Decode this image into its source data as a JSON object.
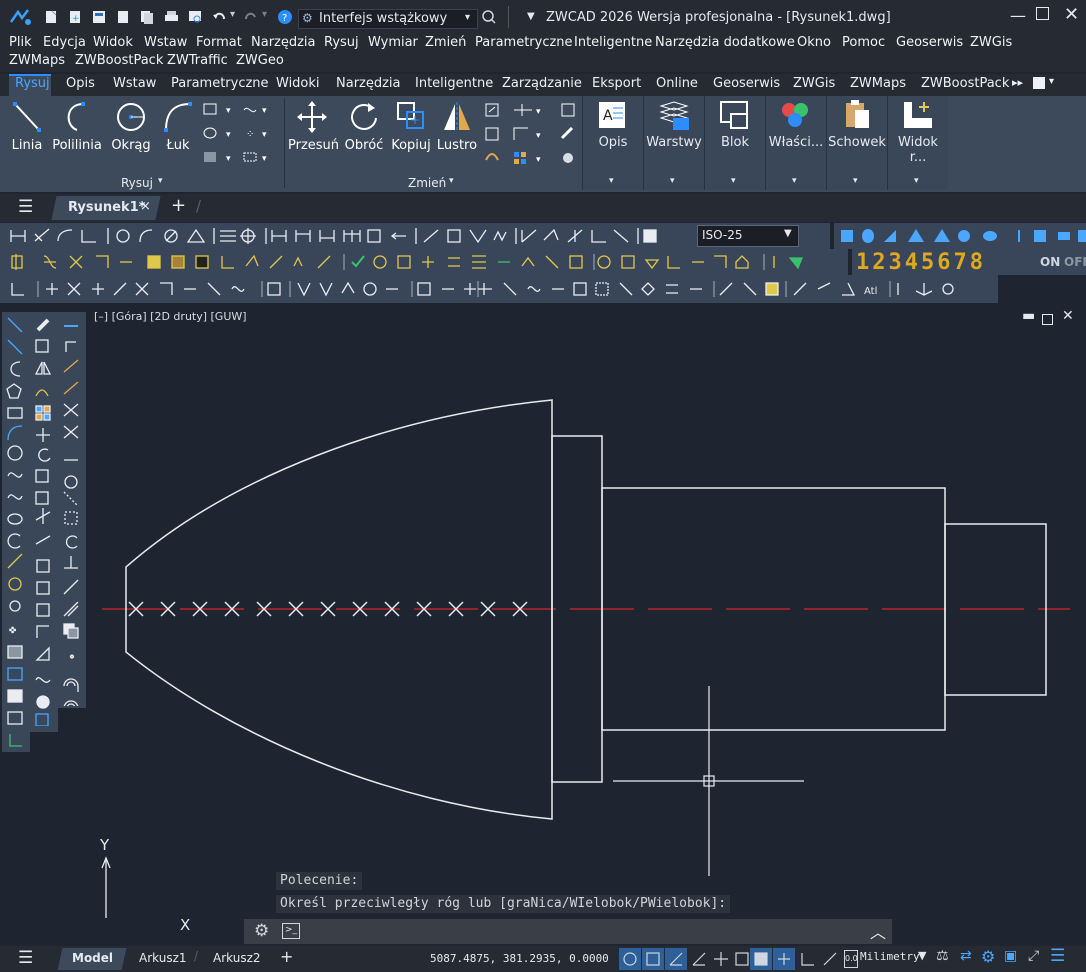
{
  "app": {
    "interface_name": "Interfejs wstążkowy",
    "title": "ZWCAD 2026 Wersja profesjonalna - [Rysunek1.dwg]",
    "window_controls": [
      "minimize-icon",
      "maximize-icon",
      "close-icon"
    ]
  },
  "menubar": {
    "row1": [
      "Plik",
      "Edycja",
      "Widok",
      "Wstaw",
      "Format",
      "Narzędzia",
      "Rysuj",
      "Wymiar",
      "Zmień",
      "Parametryczne",
      "Inteligentne",
      "Narzędzia dodatkowe",
      "Okno",
      "Pomoc",
      "Geoserwis",
      "ZWGis"
    ],
    "row2": [
      "ZWMaps",
      "ZWBoostPack",
      "ZWTraffic",
      "ZWGeo"
    ]
  },
  "ribbon_tabs": [
    "Rysuj",
    "Opis",
    "Wstaw",
    "Parametryczne",
    "Widoki",
    "Narzędzia",
    "Inteligentne",
    "Zarządzanie",
    "Eksport",
    "Online",
    "Geoserwis",
    "ZWGis",
    "ZWMaps",
    "ZWBoostPack"
  ],
  "ribbon": {
    "draw_buttons": [
      "Linia",
      "Polilinia",
      "Okrąg",
      "Łuk"
    ],
    "draw_panel_title": "Rysuj",
    "modify_buttons": [
      "Przesuń",
      "Obróć",
      "Kopiuj",
      "Lustro"
    ],
    "modify_panel_title": "Zmień",
    "panels": [
      "Opis",
      "Warstwy",
      "Blok",
      "Właści...",
      "Schowek",
      "Widok r..."
    ]
  },
  "doc_tab": {
    "label": "Rysunek1*",
    "close": "×",
    "add": "+"
  },
  "toolbar": {
    "dimstyle": "ISO-25",
    "layer_digits": "12345678",
    "on_label": "ON",
    "off_label": "OFF"
  },
  "viewport": {
    "label": "[–] [Góra] [2D druty] [GUW]"
  },
  "ucs": {
    "x": "X",
    "y": "Y"
  },
  "command": {
    "line1": "Polecenie:",
    "line2": "Określ przeciwległy róg lub [graNica/WIelobok/PWielobok]:"
  },
  "status": {
    "tabs": [
      "Model",
      "Arkusz1",
      "Arkusz2"
    ],
    "coords": "5087.4875, 381.2935, 0.0000",
    "units": "Milimetry"
  },
  "colors": {
    "accent": "#2d8cff",
    "centerline": "#b8252a",
    "ribbon": "#3d4a5c",
    "dark": "#262b33"
  }
}
